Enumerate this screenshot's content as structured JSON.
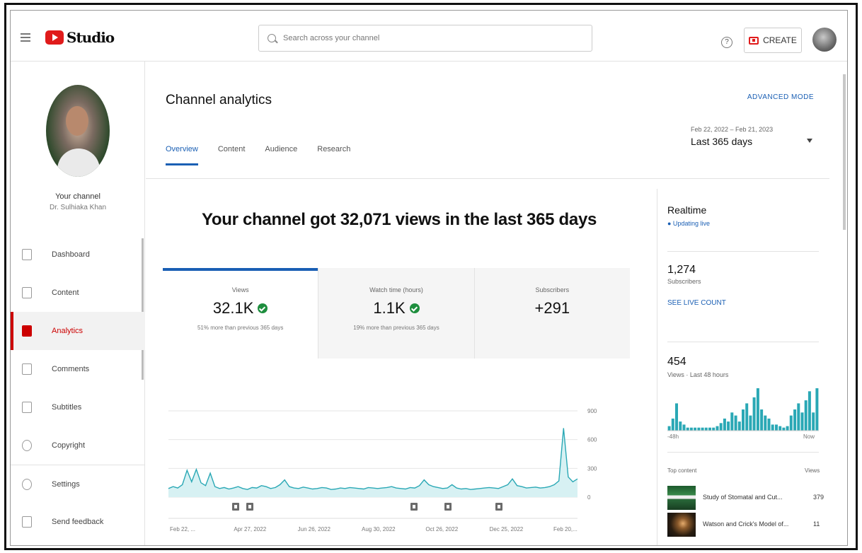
{
  "header": {
    "logo_text": "Studio",
    "search_placeholder": "Search across your channel",
    "help_icon": "?",
    "create_label": "CREATE"
  },
  "sidebar": {
    "channel_label": "Your channel",
    "channel_name": "Dr. Sulhiaka Khan",
    "items": [
      {
        "label": "Dashboard",
        "icon": "dashboard-icon"
      },
      {
        "label": "Content",
        "icon": "content-icon"
      },
      {
        "label": "Analytics",
        "icon": "analytics-icon",
        "active": true
      },
      {
        "label": "Comments",
        "icon": "comments-icon"
      },
      {
        "label": "Subtitles",
        "icon": "subtitles-icon"
      },
      {
        "label": "Copyright",
        "icon": "copyright-icon"
      },
      {
        "label": "Settings",
        "icon": "settings-icon"
      },
      {
        "label": "Send feedback",
        "icon": "feedback-icon"
      }
    ]
  },
  "main": {
    "title": "Channel analytics",
    "advanced_mode": "ADVANCED MODE",
    "date_range": "Feb 22, 2022 – Feb 21, 2023",
    "date_label": "Last 365 days",
    "tabs": [
      "Overview",
      "Content",
      "Audience",
      "Research"
    ],
    "headline": "Your channel got 32,071 views in the last 365 days",
    "cards": [
      {
        "label": "Views",
        "value": "32.1K",
        "sub": "51% more than previous 365 days",
        "check": true
      },
      {
        "label": "Watch time (hours)",
        "value": "1.1K",
        "sub": "19% more than previous 365 days",
        "check": true
      },
      {
        "label": "Subscribers",
        "value": "+291",
        "sub": "",
        "check": false
      }
    ]
  },
  "chart_data": {
    "type": "line",
    "x_tick_labels": [
      "Feb 22, ...",
      "Apr 27, 2022",
      "Jun 26, 2022",
      "Aug 30, 2022",
      "Oct 26, 2022",
      "Dec 25, 2022",
      "Feb 20,..."
    ],
    "y_tick_labels": [
      "900",
      "600",
      "300",
      "0"
    ],
    "ylim": [
      0,
      900
    ],
    "values": [
      90,
      110,
      95,
      130,
      280,
      160,
      290,
      150,
      120,
      250,
      110,
      90,
      100,
      85,
      95,
      110,
      90,
      80,
      100,
      95,
      120,
      110,
      90,
      100,
      130,
      180,
      110,
      95,
      90,
      105,
      95,
      85,
      90,
      100,
      95,
      80,
      85,
      95,
      90,
      100,
      95,
      90,
      85,
      100,
      95,
      90,
      95,
      100,
      110,
      95,
      90,
      85,
      100,
      95,
      120,
      180,
      130,
      110,
      100,
      90,
      95,
      130,
      95,
      85,
      90,
      80,
      85,
      90,
      95,
      100,
      95,
      90,
      110,
      130,
      190,
      120,
      110,
      95,
      100,
      105,
      95,
      100,
      110,
      130,
      170,
      720,
      210,
      160,
      190
    ],
    "event_markers": 6
  },
  "realtime": {
    "title": "Realtime",
    "updating": "● Updating live",
    "subscribers": "1,274",
    "subscribers_label": "Subscribers",
    "see_live_count": "SEE LIVE COUNT",
    "views": "454",
    "views_label": "Views · Last 48 hours",
    "bars": [
      3,
      8,
      18,
      6,
      4,
      2,
      2,
      2,
      2,
      2,
      2,
      2,
      2,
      3,
      5,
      8,
      6,
      12,
      10,
      6,
      14,
      18,
      10,
      22,
      28,
      14,
      10,
      8,
      4,
      4,
      3,
      2,
      3,
      10,
      14,
      18,
      12,
      20,
      26,
      12,
      28
    ],
    "axis_left": "-48h",
    "axis_right": "Now",
    "top_content_label": "Top content",
    "top_content_header": "Views",
    "top_content": [
      {
        "title": "Study of Stomatal and Cut...",
        "views": "379"
      },
      {
        "title": "Watson and Crick's Model of...",
        "views": "11"
      }
    ]
  }
}
